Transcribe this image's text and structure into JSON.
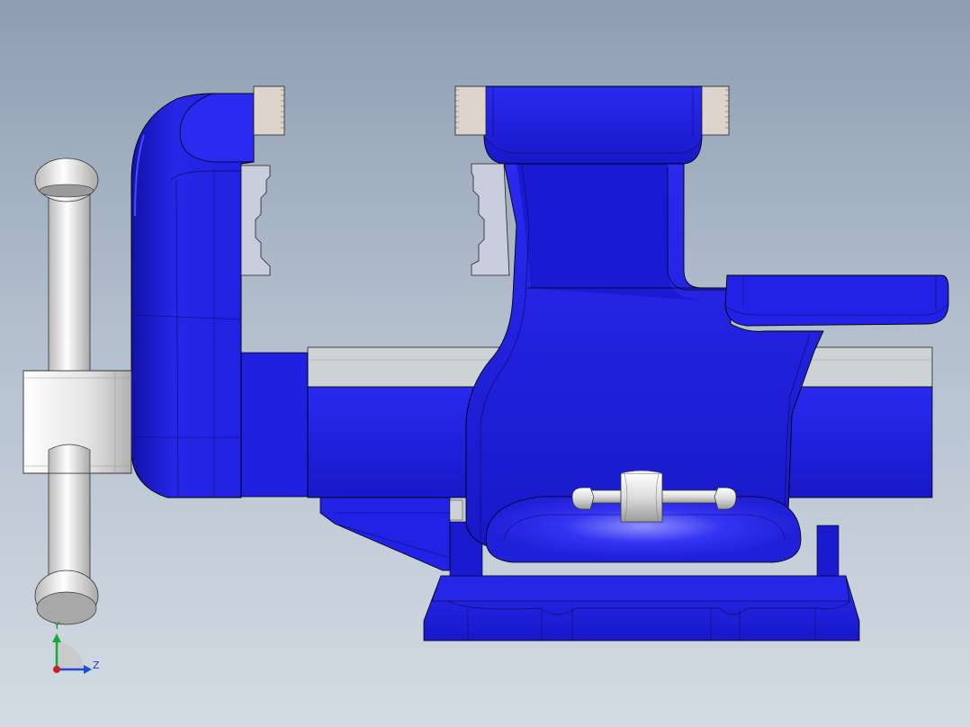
{
  "viewport": {
    "background_top": "#8e9db2",
    "background_bottom": "#d3dbe3"
  },
  "model": {
    "body_color": "#2020e6",
    "body_shade_color": "#1414b4",
    "body_highlight_color": "#3b3bf5",
    "jaw_insert_color": "#ddd5cb",
    "slide_bar_color": "#cdd2d4",
    "handle_color": "#d9d9d9"
  },
  "triad": {
    "y_label": "Y",
    "z_label": "Z",
    "y_color": "#19a83a",
    "z_color": "#1f4ad6",
    "origin_color": "#d11f1f"
  }
}
